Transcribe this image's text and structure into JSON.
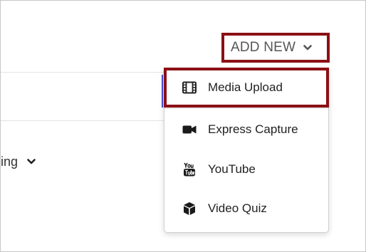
{
  "header": {
    "add_new_label": "ADD NEW",
    "add_new_icon": "chevron-down-icon"
  },
  "sort": {
    "label_partial": "ing",
    "icon": "chevron-down-icon"
  },
  "menu": {
    "items": [
      {
        "label": "Media Upload",
        "icon": "film-icon",
        "highlighted": true
      },
      {
        "label": "Express Capture",
        "icon": "video-camera-icon"
      },
      {
        "label": "YouTube",
        "icon": "youtube-icon"
      },
      {
        "label": "Video Quiz",
        "icon": "cube-icon"
      }
    ]
  },
  "colors": {
    "highlight_border": "#8b1015",
    "text_gray": "#555555",
    "text_dark": "#222222",
    "divider": "#e3e3e3",
    "input_focus": "#4b4bd1"
  }
}
